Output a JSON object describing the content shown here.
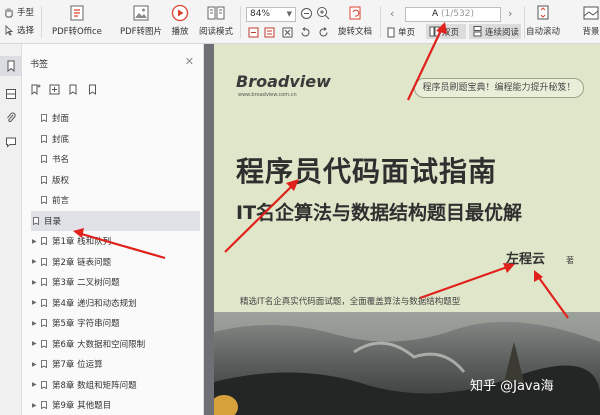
{
  "toolbar": {
    "hand_tool": "手型",
    "select_tool": "选择",
    "pdf_to_office": "PDF转Office",
    "pdf_to_image": "PDF转图片",
    "play": "播放",
    "read_mode": "阅读模式",
    "zoom_value": "84%",
    "rotate_doc": "旋转文档",
    "single_page": "单页",
    "double_page": "双页",
    "continuous_read": "连续阅读",
    "auto_scroll": "自动滚动",
    "background": "背景",
    "page_prefix": "A",
    "page_count": "(1/532)"
  },
  "bookmarks": {
    "title": "书签",
    "items": [
      {
        "label": "封面",
        "expandable": false,
        "selected": false
      },
      {
        "label": "封底",
        "expandable": false,
        "selected": false
      },
      {
        "label": "书名",
        "expandable": false,
        "selected": false
      },
      {
        "label": "版权",
        "expandable": false,
        "selected": false
      },
      {
        "label": "前言",
        "expandable": false,
        "selected": false
      },
      {
        "label": "目录",
        "expandable": false,
        "selected": true
      },
      {
        "label": "第1章 栈和队列",
        "expandable": true,
        "selected": false
      },
      {
        "label": "第2章 链表问题",
        "expandable": true,
        "selected": false
      },
      {
        "label": "第3章 二叉树问题",
        "expandable": true,
        "selected": false
      },
      {
        "label": "第4章 递归和动态规划",
        "expandable": true,
        "selected": false
      },
      {
        "label": "第5章 字符串问题",
        "expandable": true,
        "selected": false
      },
      {
        "label": "第6章 大数据和空间限制",
        "expandable": true,
        "selected": false
      },
      {
        "label": "第7章 位运算",
        "expandable": true,
        "selected": false
      },
      {
        "label": "第8章 数组和矩阵问题",
        "expandable": true,
        "selected": false
      },
      {
        "label": "第9章 其他题目",
        "expandable": true,
        "selected": false
      }
    ]
  },
  "cover": {
    "publisher": "Broadview",
    "publisher_url": "www.broadview.com.cn",
    "banner": "程序员刷题宝典！编程能力提升秘笈！",
    "title": "程序员代码面试指南",
    "subtitle": "IT名企算法与数据结构题目最优解",
    "author": "左程云",
    "author_suffix": "著",
    "tagline": "精选IT名企真实代码面试题，全面覆盖算法与数据结构题型"
  },
  "watermark": "知乎 @Java海",
  "colors": {
    "toolbar_bg": "#f4f4f4",
    "panel_bg": "#fafafa",
    "selected_bg": "#dfe1e6",
    "doc_bg": "#7d7f84",
    "cover_bg": "#dfe6c9",
    "annotation_red": "#e0211c",
    "play_red": "#d9442f"
  }
}
